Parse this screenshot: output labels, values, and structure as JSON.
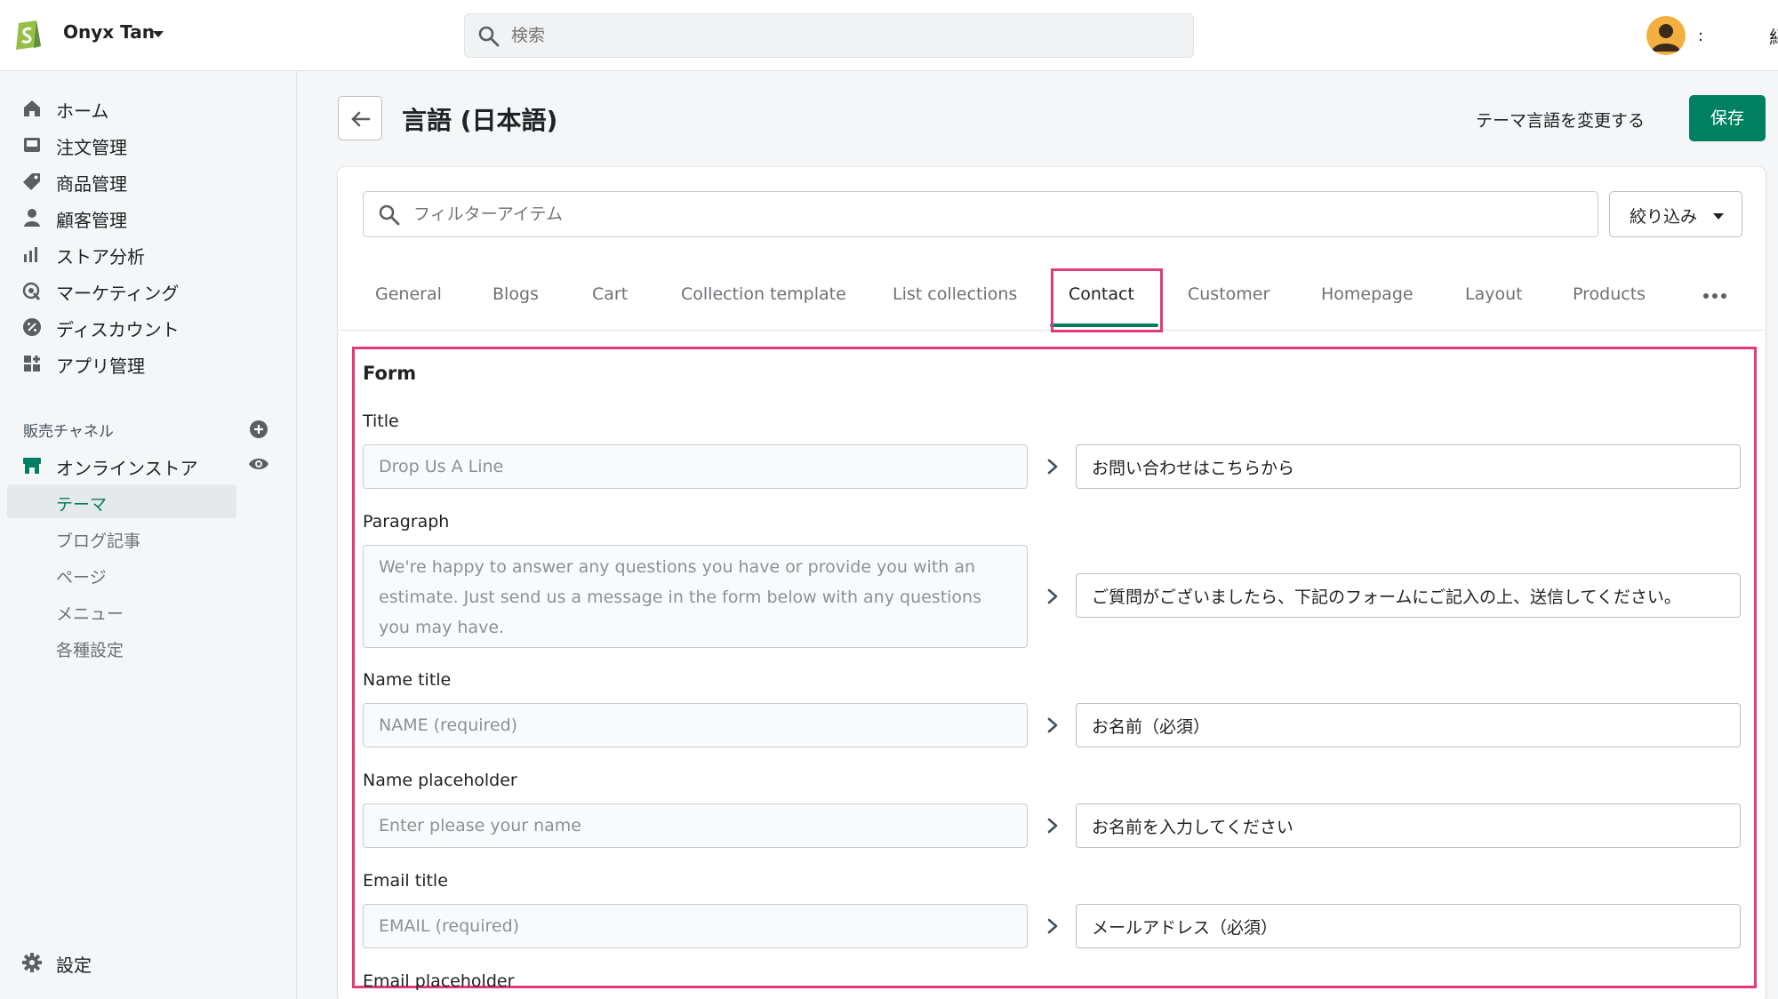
{
  "topbar": {
    "store_name": "Onyx Tan",
    "search_placeholder": "検索",
    "colon": ":",
    "truncated_text": "紀"
  },
  "sidebar": {
    "items": [
      {
        "label": "ホーム",
        "icon": "home-icon"
      },
      {
        "label": "注文管理",
        "icon": "inbox-icon"
      },
      {
        "label": "商品管理",
        "icon": "tag-icon"
      },
      {
        "label": "顧客管理",
        "icon": "person-icon"
      },
      {
        "label": "ストア分析",
        "icon": "bar-chart-icon"
      },
      {
        "label": "マーケティング",
        "icon": "target-icon"
      },
      {
        "label": "ディスカウント",
        "icon": "discount-icon"
      },
      {
        "label": "アプリ管理",
        "icon": "apps-icon"
      }
    ],
    "section_label": "販売チャネル",
    "channel": {
      "label": "オンラインストア",
      "icon": "store-icon"
    },
    "sub_items": [
      {
        "label": "テーマ",
        "active": true
      },
      {
        "label": "ブログ記事",
        "active": false
      },
      {
        "label": "ページ",
        "active": false
      },
      {
        "label": "メニュー",
        "active": false
      },
      {
        "label": "各種設定",
        "active": false
      }
    ],
    "settings_label": "設定"
  },
  "header": {
    "title": "言語 (日本語)",
    "change_language": "テーマ言語を変更する",
    "save_label": "保存"
  },
  "filter": {
    "placeholder": "フィルターアイテム",
    "filter_button": "絞り込み"
  },
  "tabs": [
    {
      "label": "General",
      "active": false
    },
    {
      "label": "Blogs",
      "active": false
    },
    {
      "label": "Cart",
      "active": false
    },
    {
      "label": "Collection template",
      "active": false
    },
    {
      "label": "List collections",
      "active": false
    },
    {
      "label": "Contact",
      "active": true
    },
    {
      "label": "Customer",
      "active": false
    },
    {
      "label": "Homepage",
      "active": false
    },
    {
      "label": "Layout",
      "active": false
    },
    {
      "label": "Products",
      "active": false
    }
  ],
  "form": {
    "section_title": "Form",
    "fields": [
      {
        "label": "Title",
        "source": "Drop Us A Line",
        "translation": "お問い合わせはこちらから"
      },
      {
        "label": "Paragraph",
        "source": "We're happy to answer any questions you have or provide you with an estimate. Just send us a message in the form below with any questions you may have.",
        "translation": "ご質問がございましたら、下記のフォームにご記入の上、送信してください。"
      },
      {
        "label": "Name title",
        "source": "NAME (required)",
        "translation": "お名前（必須）"
      },
      {
        "label": "Name placeholder",
        "source": "Enter please your name",
        "translation": "お名前を入力してください"
      },
      {
        "label": "Email title",
        "source": "EMAIL (required)",
        "translation": "メールアドレス（必須）"
      },
      {
        "label": "Email placeholder"
      }
    ]
  },
  "colors": {
    "primary": "#008060",
    "highlight": "#e4397b"
  }
}
